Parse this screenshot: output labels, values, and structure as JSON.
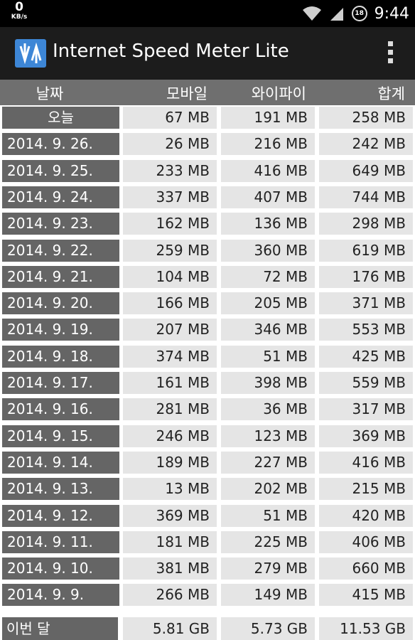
{
  "statusbar": {
    "speed_value": "0",
    "speed_unit": "KB/s",
    "battery_label": "18",
    "time": "9:44"
  },
  "actionbar": {
    "title": "Internet Speed Meter Lite"
  },
  "columns": {
    "date": "날짜",
    "mobile": "모바일",
    "wifi": "와이파이",
    "total": "합계"
  },
  "rows": [
    {
      "date": "오늘",
      "mobile": "67 MB",
      "wifi": "191 MB",
      "total": "258 MB"
    },
    {
      "date": "2014. 9. 26.",
      "mobile": "26 MB",
      "wifi": "216 MB",
      "total": "242 MB"
    },
    {
      "date": "2014. 9. 25.",
      "mobile": "233 MB",
      "wifi": "416 MB",
      "total": "649 MB"
    },
    {
      "date": "2014. 9. 24.",
      "mobile": "337 MB",
      "wifi": "407 MB",
      "total": "744 MB"
    },
    {
      "date": "2014. 9. 23.",
      "mobile": "162 MB",
      "wifi": "136 MB",
      "total": "298 MB"
    },
    {
      "date": "2014. 9. 22.",
      "mobile": "259 MB",
      "wifi": "360 MB",
      "total": "619 MB"
    },
    {
      "date": "2014. 9. 21.",
      "mobile": "104 MB",
      "wifi": "72 MB",
      "total": "176 MB"
    },
    {
      "date": "2014. 9. 20.",
      "mobile": "166 MB",
      "wifi": "205 MB",
      "total": "371 MB"
    },
    {
      "date": "2014. 9. 19.",
      "mobile": "207 MB",
      "wifi": "346 MB",
      "total": "553 MB"
    },
    {
      "date": "2014. 9. 18.",
      "mobile": "374 MB",
      "wifi": "51 MB",
      "total": "425 MB"
    },
    {
      "date": "2014. 9. 17.",
      "mobile": "161 MB",
      "wifi": "398 MB",
      "total": "559 MB"
    },
    {
      "date": "2014. 9. 16.",
      "mobile": "281 MB",
      "wifi": "36 MB",
      "total": "317 MB"
    },
    {
      "date": "2014. 9. 15.",
      "mobile": "246 MB",
      "wifi": "123 MB",
      "total": "369 MB"
    },
    {
      "date": "2014. 9. 14.",
      "mobile": "189 MB",
      "wifi": "227 MB",
      "total": "416 MB"
    },
    {
      "date": "2014. 9. 13.",
      "mobile": "13 MB",
      "wifi": "202 MB",
      "total": "215 MB"
    },
    {
      "date": "2014. 9. 12.",
      "mobile": "369 MB",
      "wifi": "51 MB",
      "total": "420 MB"
    },
    {
      "date": "2014. 9. 11.",
      "mobile": "181 MB",
      "wifi": "225 MB",
      "total": "406 MB"
    },
    {
      "date": "2014. 9. 10.",
      "mobile": "381 MB",
      "wifi": "279 MB",
      "total": "660 MB"
    },
    {
      "date": "2014. 9. 9.",
      "mobile": "266 MB",
      "wifi": "149 MB",
      "total": "415 MB"
    }
  ],
  "footer": {
    "label": "이번 달",
    "mobile": "5.81 GB",
    "wifi": "5.73 GB",
    "total": "11.53 GB"
  },
  "colors": {
    "statusbar_bg": "#000000",
    "actionbar_bg": "#1c1c1c",
    "header_bg": "#6f6f6f",
    "date_cell_bg": "#656565",
    "value_cell_bg": "#e5e5e5",
    "app_icon_bg": "#3d86d6"
  }
}
